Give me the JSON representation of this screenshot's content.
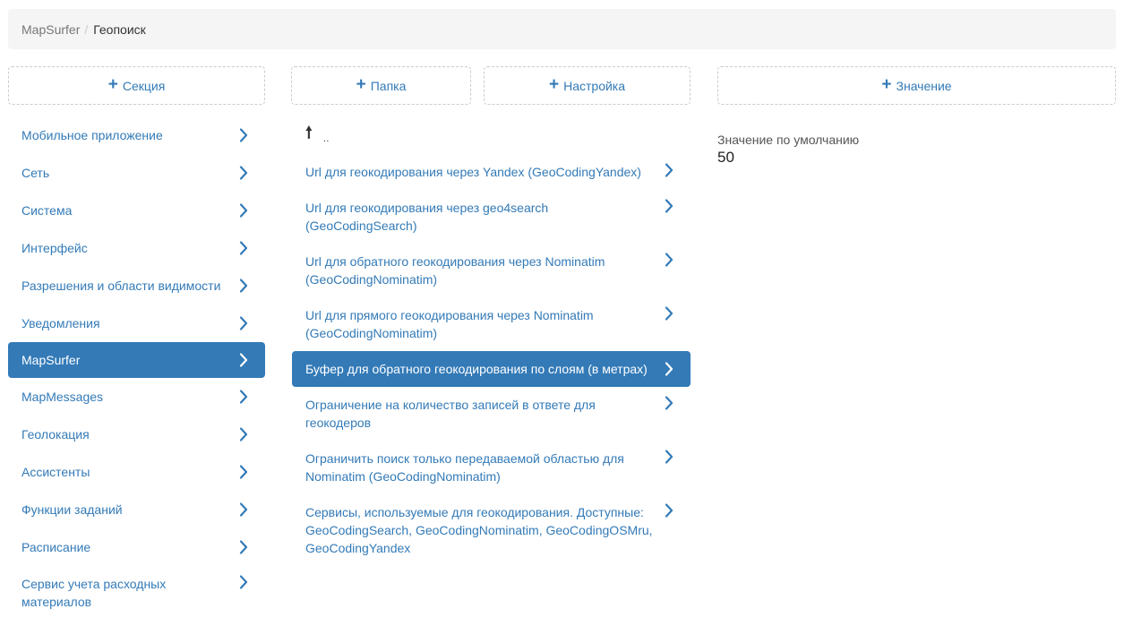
{
  "breadcrumb": {
    "root": "MapSurfer",
    "separator": "/",
    "current": "Геопоиск"
  },
  "buttons": {
    "add_section": "Секция",
    "add_folder": "Папка",
    "add_setting": "Настройка",
    "add_value": "Значение",
    "plus_glyph": "+"
  },
  "sections": [
    "Мобильное приложение",
    "Сеть",
    "Система",
    "Интерфейс",
    "Разрешения и области видимости",
    "Уведомления",
    "MapSurfer",
    "MapMessages",
    "Геолокация",
    "Ассистенты",
    "Функции заданий",
    "Расписание",
    "Сервис учета расходных материалов"
  ],
  "active_section": "MapSurfer",
  "folder_up": {
    "arrow": "🠕",
    "label": ".."
  },
  "settings": [
    "Url для геокодирования через Yandex (GeoCodingYandex)",
    "Url для геокодирования через geo4search (GeoCodingSearch)",
    "Url для обратного геокодирования через Nominatim (GeoCodingNominatim)",
    "Url для прямого геокодирования через Nominatim (GeoCodingNominatim)",
    "Буфер для обратного геокодирования по слоям (в метрах)",
    "Ограничение на количество записей в ответе для геокодеров",
    "Ограничить поиск только передаваемой областью для Nominatim (GeoCodingNominatim)",
    "Сервисы, используемые для геокодирования. Доступные: GeoCodingSearch, GeoCodingNominatim, GeoCodingOSMru, GeoCodingYandex"
  ],
  "active_setting": "Буфер для обратного геокодирования по слоям (в метрах)",
  "value_panel": {
    "label": "Значение по умолчанию",
    "value": "50"
  },
  "colors": {
    "accent": "#337ab7",
    "breadcrumb_bg": "#f5f5f5"
  },
  "icons": {
    "chevron": "chevron-right-icon",
    "plus": "plus-icon",
    "up": "arrow-up-icon"
  }
}
